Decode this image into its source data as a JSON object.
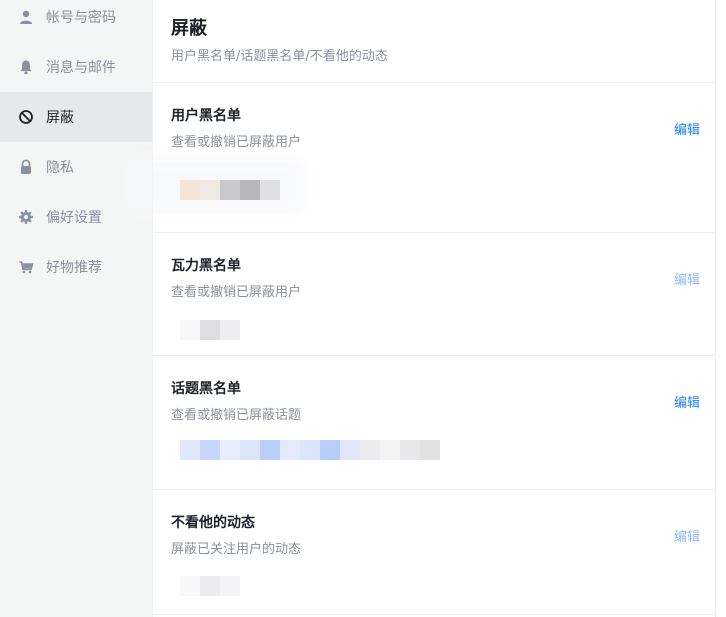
{
  "sidebar": {
    "items": [
      {
        "label": "帐号与密码",
        "icon": "user-icon"
      },
      {
        "label": "消息与邮件",
        "icon": "bell-icon"
      },
      {
        "label": "屏蔽",
        "icon": "block-icon"
      },
      {
        "label": "隐私",
        "icon": "lock-icon"
      },
      {
        "label": "偏好设置",
        "icon": "gear-icon"
      },
      {
        "label": "好物推荐",
        "icon": "cart-icon"
      }
    ],
    "active_index": 2
  },
  "page": {
    "title": "屏蔽",
    "subtitle": "用户黑名单/话题黑名单/不看他的动态"
  },
  "sections": [
    {
      "title": "用户黑名单",
      "desc": "查看或撤销已屏蔽用户",
      "edit": "编辑",
      "edit_enabled": true
    },
    {
      "title": "瓦力黑名单",
      "desc": "查看或撤销已屏蔽用户",
      "edit": "编辑",
      "edit_enabled": false
    },
    {
      "title": "话题黑名单",
      "desc": "查看或撤销已屏蔽话题",
      "edit": "编辑",
      "edit_enabled": true
    },
    {
      "title": "不看他的动态",
      "desc": "屏蔽已关注用户的动态",
      "edit": "编辑",
      "edit_enabled": false
    }
  ],
  "colors": {
    "accent": "#1e80ff",
    "accent_disabled": "#90b9f0",
    "text_primary": "#1d2129",
    "text_secondary": "#8a919f",
    "sidebar_bg": "#f4f5f5",
    "sidebar_active_bg": "#e7e8eb"
  }
}
